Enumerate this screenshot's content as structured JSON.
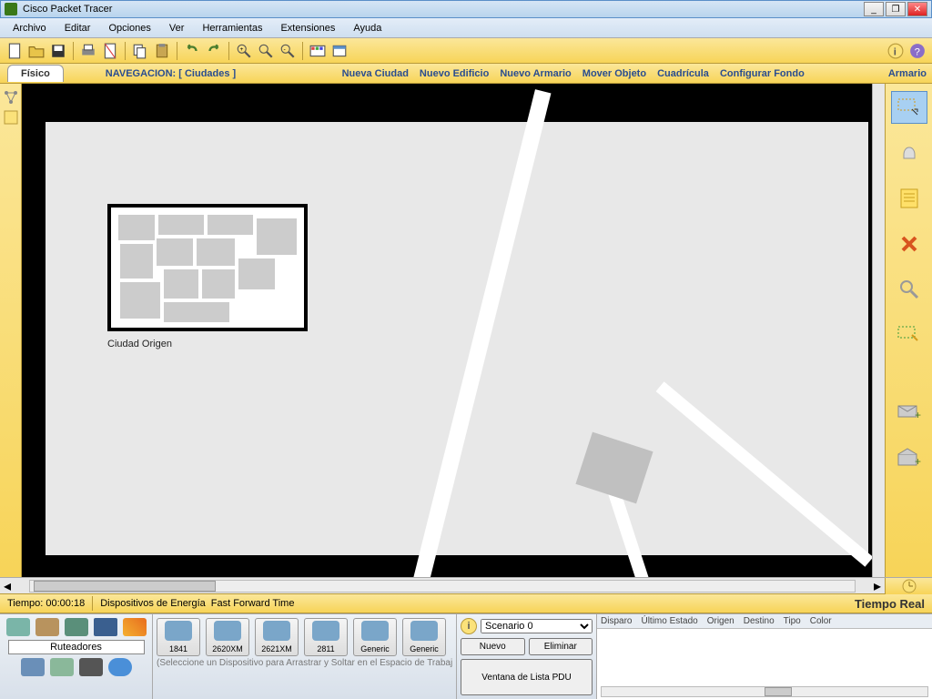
{
  "title": "Cisco Packet Tracer",
  "menu": {
    "archivo": "Archivo",
    "editar": "Editar",
    "opciones": "Opciones",
    "ver": "Ver",
    "herramientas": "Herramientas",
    "extensiones": "Extensiones",
    "ayuda": "Ayuda"
  },
  "physbar": {
    "tab": "Físico",
    "nav": "NAVEGACION: [ Ciudades ]",
    "cmds": {
      "c1": "Nueva Ciudad",
      "c2": "Nuevo Edificio",
      "c3": "Nuevo Armario",
      "c4": "Mover Objeto",
      "c5": "Cuadrícula",
      "c6": "Configurar Fondo"
    },
    "right": "Armario"
  },
  "canvas": {
    "city_label": "Ciudad Origen"
  },
  "timebar": {
    "tiempo": "Tiempo: 00:00:18",
    "energia": "Dispositivos de Energía",
    "fft": "Fast Forward Time",
    "real": "Tiempo Real"
  },
  "devices": {
    "category": "Ruteadores",
    "routers": {
      "r1": "1841",
      "r2": "2620XM",
      "r3": "2621XM",
      "r4": "2811",
      "r5": "Generic",
      "r6": "Generic"
    },
    "hint": "(Seleccione un Dispositivo para Arrastrar y Soltar en el Espacio de Trabajo)"
  },
  "scenario": {
    "name": "Scenario 0",
    "nuevo": "Nuevo",
    "eliminar": "Eliminar",
    "ventana": "Ventana de Lista PDU"
  },
  "pdu": {
    "disparo": "Disparo",
    "ultimo": "Último Estado",
    "origen": "Origen",
    "destino": "Destino",
    "tipo": "Tipo",
    "color": "Color"
  }
}
